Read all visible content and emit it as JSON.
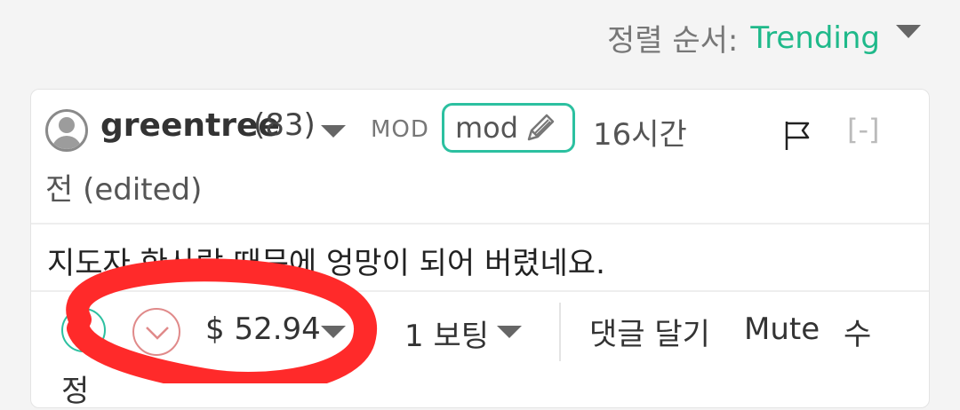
{
  "sort": {
    "label": "정렬 순서:",
    "value": "Trending"
  },
  "comment": {
    "author": "greentree",
    "reputation": "(83)",
    "mod_label": "MOD",
    "mod_badge": "mod",
    "time": "16시간 전 (edited)",
    "collapse": "[-]",
    "body": "지도자 한사람 때문에 엉망이 되어 버렸네요.",
    "payout": "$ 52.94",
    "votes": "1 보팅",
    "reply": "댓글 달기",
    "mute": "Mute",
    "more": "수",
    "more2": "정"
  },
  "colors": {
    "accent": "#1fb98a",
    "downvote": "#e08a8a",
    "annotation": "#ff2a2a"
  }
}
